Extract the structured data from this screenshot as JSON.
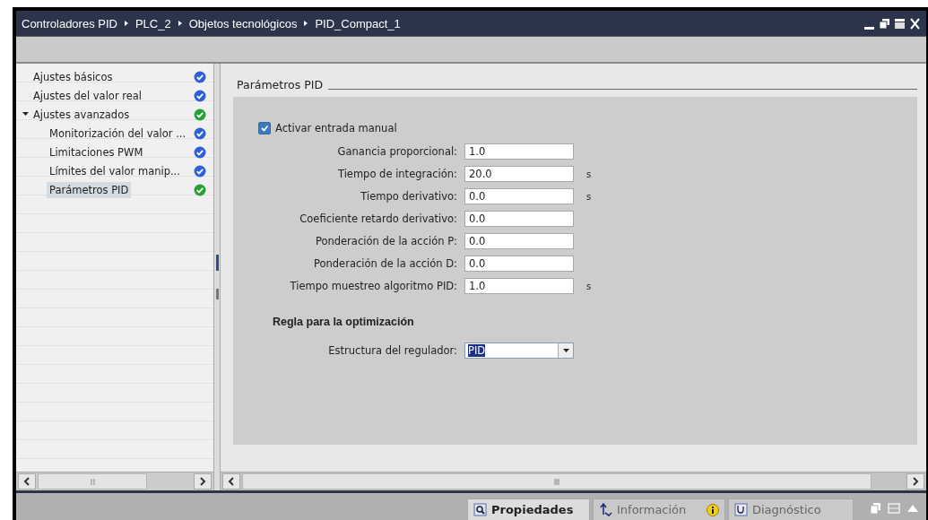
{
  "window": {
    "breadcrumb": [
      "Controladores PID",
      "PLC_2",
      "Objetos tecnológicos",
      "PID_Compact_1"
    ]
  },
  "sidebar": {
    "items": [
      {
        "label": "Ajustes básicos",
        "color": "#2f5fd8",
        "selected": false
      },
      {
        "label": "Ajustes del valor real",
        "color": "#2f5fd8",
        "selected": false
      },
      {
        "label": "Ajustes avanzados",
        "color": "#23a233",
        "selected": false,
        "expanded": true,
        "children": [
          {
            "label": "Monitorización del valor ...",
            "color": "#2f5fd8",
            "selected": false
          },
          {
            "label": "Limitaciones PWM",
            "color": "#2f5fd8",
            "selected": false
          },
          {
            "label": "Límites del valor manip...",
            "color": "#2f5fd8",
            "selected": false
          },
          {
            "label": "Parámetros PID",
            "color": "#23a233",
            "selected": true
          }
        ]
      }
    ]
  },
  "section_title": "Parámetros PID",
  "checkbox": {
    "label": "Activar entrada manual",
    "checked": true
  },
  "fields": [
    {
      "label": "Ganancia proporcional:",
      "value": "1.0"
    },
    {
      "label": "Tiempo de integración:",
      "value": "20.0",
      "unit": "s"
    },
    {
      "label": "Tiempo derivativo:",
      "value": "0.0",
      "unit": "s"
    },
    {
      "label": "Coeficiente retardo derivativo:",
      "value": "0.0"
    },
    {
      "label": "Ponderación de la acción P:",
      "value": "0.0"
    },
    {
      "label": "Ponderación de la acción D:",
      "value": "0.0"
    },
    {
      "label": "Tiempo muestreo algoritmo PID:",
      "value": "1.0",
      "unit": "s"
    }
  ],
  "subheading": "Regla para la optimización",
  "dropdown": {
    "label": "Estructura del regulador:",
    "value": "PID"
  },
  "bottom_tabs": [
    {
      "label": "Propiedades",
      "kind": "properties",
      "selected": true
    },
    {
      "label": "Información",
      "kind": "info",
      "selected": false
    },
    {
      "label": "Diagnóstico",
      "kind": "diagnostics",
      "selected": false
    }
  ]
}
